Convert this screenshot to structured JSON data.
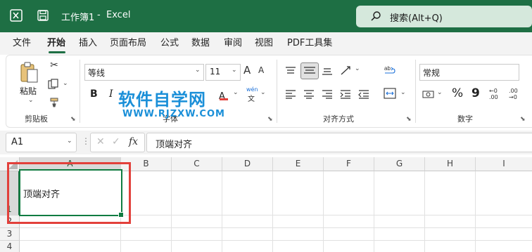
{
  "titlebar": {
    "doc_title": "工作簿1",
    "separator": "-",
    "app_name": "Excel",
    "search_placeholder": "搜索(Alt+Q)"
  },
  "menu": {
    "items": [
      "文件",
      "开始",
      "插入",
      "页面布局",
      "公式",
      "数据",
      "审阅",
      "视图",
      "PDF工具集"
    ],
    "active": "开始"
  },
  "ribbon": {
    "clipboard": {
      "paste_label": "粘贴",
      "group_label": "剪贴板"
    },
    "font": {
      "font_name": "等线",
      "font_size": "11",
      "group_label": "字体",
      "bold": "B",
      "italic": "I",
      "grow_label": "A",
      "shrink_label": "A",
      "phonetic_top": "wén",
      "phonetic_bottom": "文"
    },
    "alignment": {
      "group_label": "对齐方式"
    },
    "number": {
      "format": "常规",
      "group_label": "数字",
      "percent": "%",
      "comma": "9",
      "inc_decimal": "←0 .00",
      "dec_decimal": ".00 →0"
    }
  },
  "formula_bar": {
    "name_box": "A1",
    "fx": "fx",
    "content": "顶端对齐"
  },
  "grid": {
    "columns": [
      "A",
      "B",
      "C",
      "D",
      "E",
      "F",
      "G",
      "H",
      "I"
    ],
    "rows": [
      "1",
      "2",
      "3",
      "4"
    ],
    "cell_A1": "顶端对齐"
  },
  "watermark": {
    "title": "软件自学网",
    "url": "WWW.RJZXW.COM"
  },
  "colors": {
    "excel_green": "#1e6f44",
    "selection_border": "#107c41",
    "highlight_red": "#e2403b",
    "watermark_blue": "#1a8fd8"
  }
}
